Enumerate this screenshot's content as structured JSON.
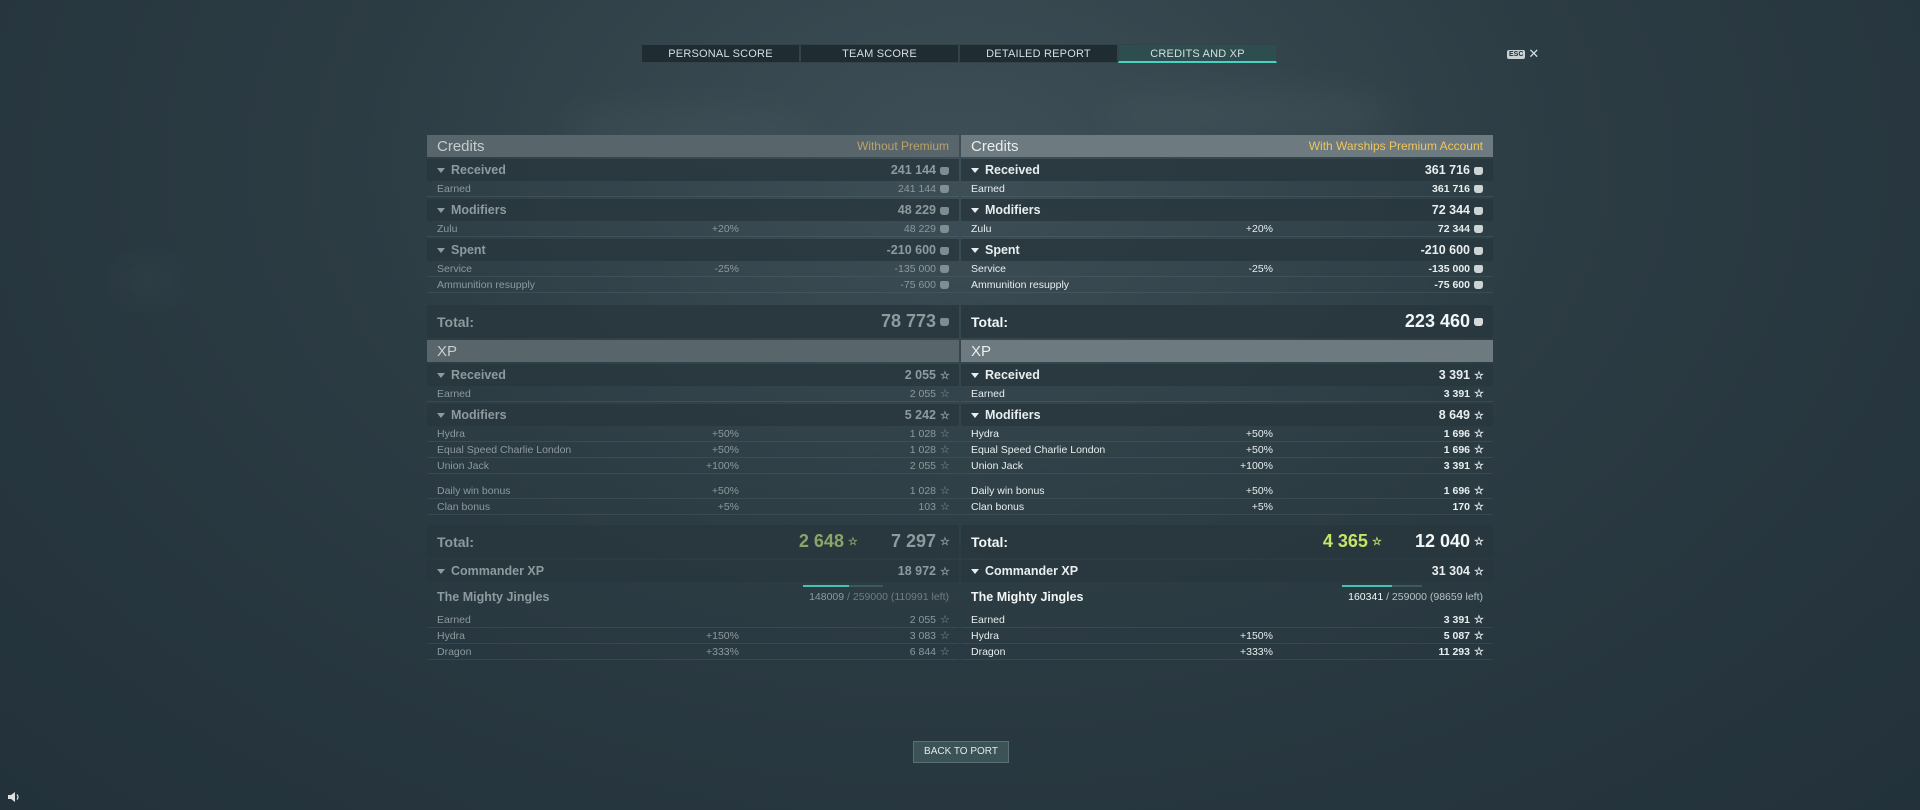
{
  "tabs": [
    "Personal score",
    "Team score",
    "Detailed report",
    "Credits and XP"
  ],
  "esc": {
    "key": "ESC",
    "close": "✕"
  },
  "left": {
    "credits_title": "Credits",
    "credits_mode": "Without Premium",
    "received": {
      "label": "Received",
      "value": "241 144"
    },
    "earned": {
      "label": "Earned",
      "value": "241 144"
    },
    "modifiers": {
      "label": "Modifiers",
      "value": "48 229"
    },
    "zulu": {
      "label": "Zulu",
      "pct": "+20%",
      "value": "48 229"
    },
    "spent": {
      "label": "Spent",
      "value": "-210 600"
    },
    "service": {
      "label": "Service",
      "pct": "-25%",
      "value": "-135 000"
    },
    "ammo": {
      "label": "Ammunition resupply",
      "value": "-75 600"
    },
    "credits_total": {
      "label": "Total:",
      "value": "78 773"
    },
    "xp_title": "XP",
    "xp_received": {
      "label": "Received",
      "value": "2 055"
    },
    "xp_earned": {
      "label": "Earned",
      "value": "2 055"
    },
    "xp_modifiers": {
      "label": "Modifiers",
      "value": "5 242"
    },
    "hydra": {
      "label": "Hydra",
      "pct": "+50%",
      "value": "1 028"
    },
    "escl": {
      "label": "Equal Speed Charlie London",
      "pct": "+50%",
      "value": "1 028"
    },
    "uj": {
      "label": "Union Jack",
      "pct": "+100%",
      "value": "2 055"
    },
    "dwb": {
      "label": "Daily win bonus",
      "pct": "+50%",
      "value": "1 028"
    },
    "clan": {
      "label": "Clan bonus",
      "pct": "+5%",
      "value": "103"
    },
    "xp_total": {
      "label": "Total:",
      "a": "2 648",
      "b": "7 297"
    },
    "cmd_xp": {
      "label": "Commander XP",
      "value": "18 972"
    },
    "commander": {
      "name": "The Mighty Jingles",
      "current": "148009",
      "rest": "/ 259000 (110991 left)",
      "progress": 0.5714
    },
    "c_earned": {
      "label": "Earned",
      "value": "2 055"
    },
    "c_hydra": {
      "label": "Hydra",
      "pct": "+150%",
      "value": "3 083"
    },
    "c_dragon": {
      "label": "Dragon",
      "pct": "+333%",
      "value": "6 844"
    }
  },
  "right": {
    "credits_title": "Credits",
    "credits_mode": "With Warships Premium Account",
    "received": {
      "label": "Received",
      "value": "361 716"
    },
    "earned": {
      "label": "Earned",
      "value": "361 716"
    },
    "modifiers": {
      "label": "Modifiers",
      "value": "72 344"
    },
    "zulu": {
      "label": "Zulu",
      "pct": "+20%",
      "value": "72 344"
    },
    "spent": {
      "label": "Spent",
      "value": "-210 600"
    },
    "service": {
      "label": "Service",
      "pct": "-25%",
      "value": "-135 000"
    },
    "ammo": {
      "label": "Ammunition resupply",
      "value": "-75 600"
    },
    "credits_total": {
      "label": "Total:",
      "value": "223 460"
    },
    "xp_title": "XP",
    "xp_received": {
      "label": "Received",
      "value": "3 391"
    },
    "xp_earned": {
      "label": "Earned",
      "value": "3 391"
    },
    "xp_modifiers": {
      "label": "Modifiers",
      "value": "8 649"
    },
    "hydra": {
      "label": "Hydra",
      "pct": "+50%",
      "value": "1 696"
    },
    "escl": {
      "label": "Equal Speed Charlie London",
      "pct": "+50%",
      "value": "1 696"
    },
    "uj": {
      "label": "Union Jack",
      "pct": "+100%",
      "value": "3 391"
    },
    "dwb": {
      "label": "Daily win bonus",
      "pct": "+50%",
      "value": "1 696"
    },
    "clan": {
      "label": "Clan bonus",
      "pct": "+5%",
      "value": "170"
    },
    "xp_total": {
      "label": "Total:",
      "a": "4 365",
      "b": "12 040"
    },
    "cmd_xp": {
      "label": "Commander XP",
      "value": "31 304"
    },
    "commander": {
      "name": "The Mighty Jingles",
      "current": "160341",
      "rest": "/ 259000 (98659 left)",
      "progress": 0.6191
    },
    "c_earned": {
      "label": "Earned",
      "value": "3 391"
    },
    "c_hydra": {
      "label": "Hydra",
      "pct": "+150%",
      "value": "5 087"
    },
    "c_dragon": {
      "label": "Dragon",
      "pct": "+333%",
      "value": "11 293"
    }
  },
  "back_button": "Back to port"
}
